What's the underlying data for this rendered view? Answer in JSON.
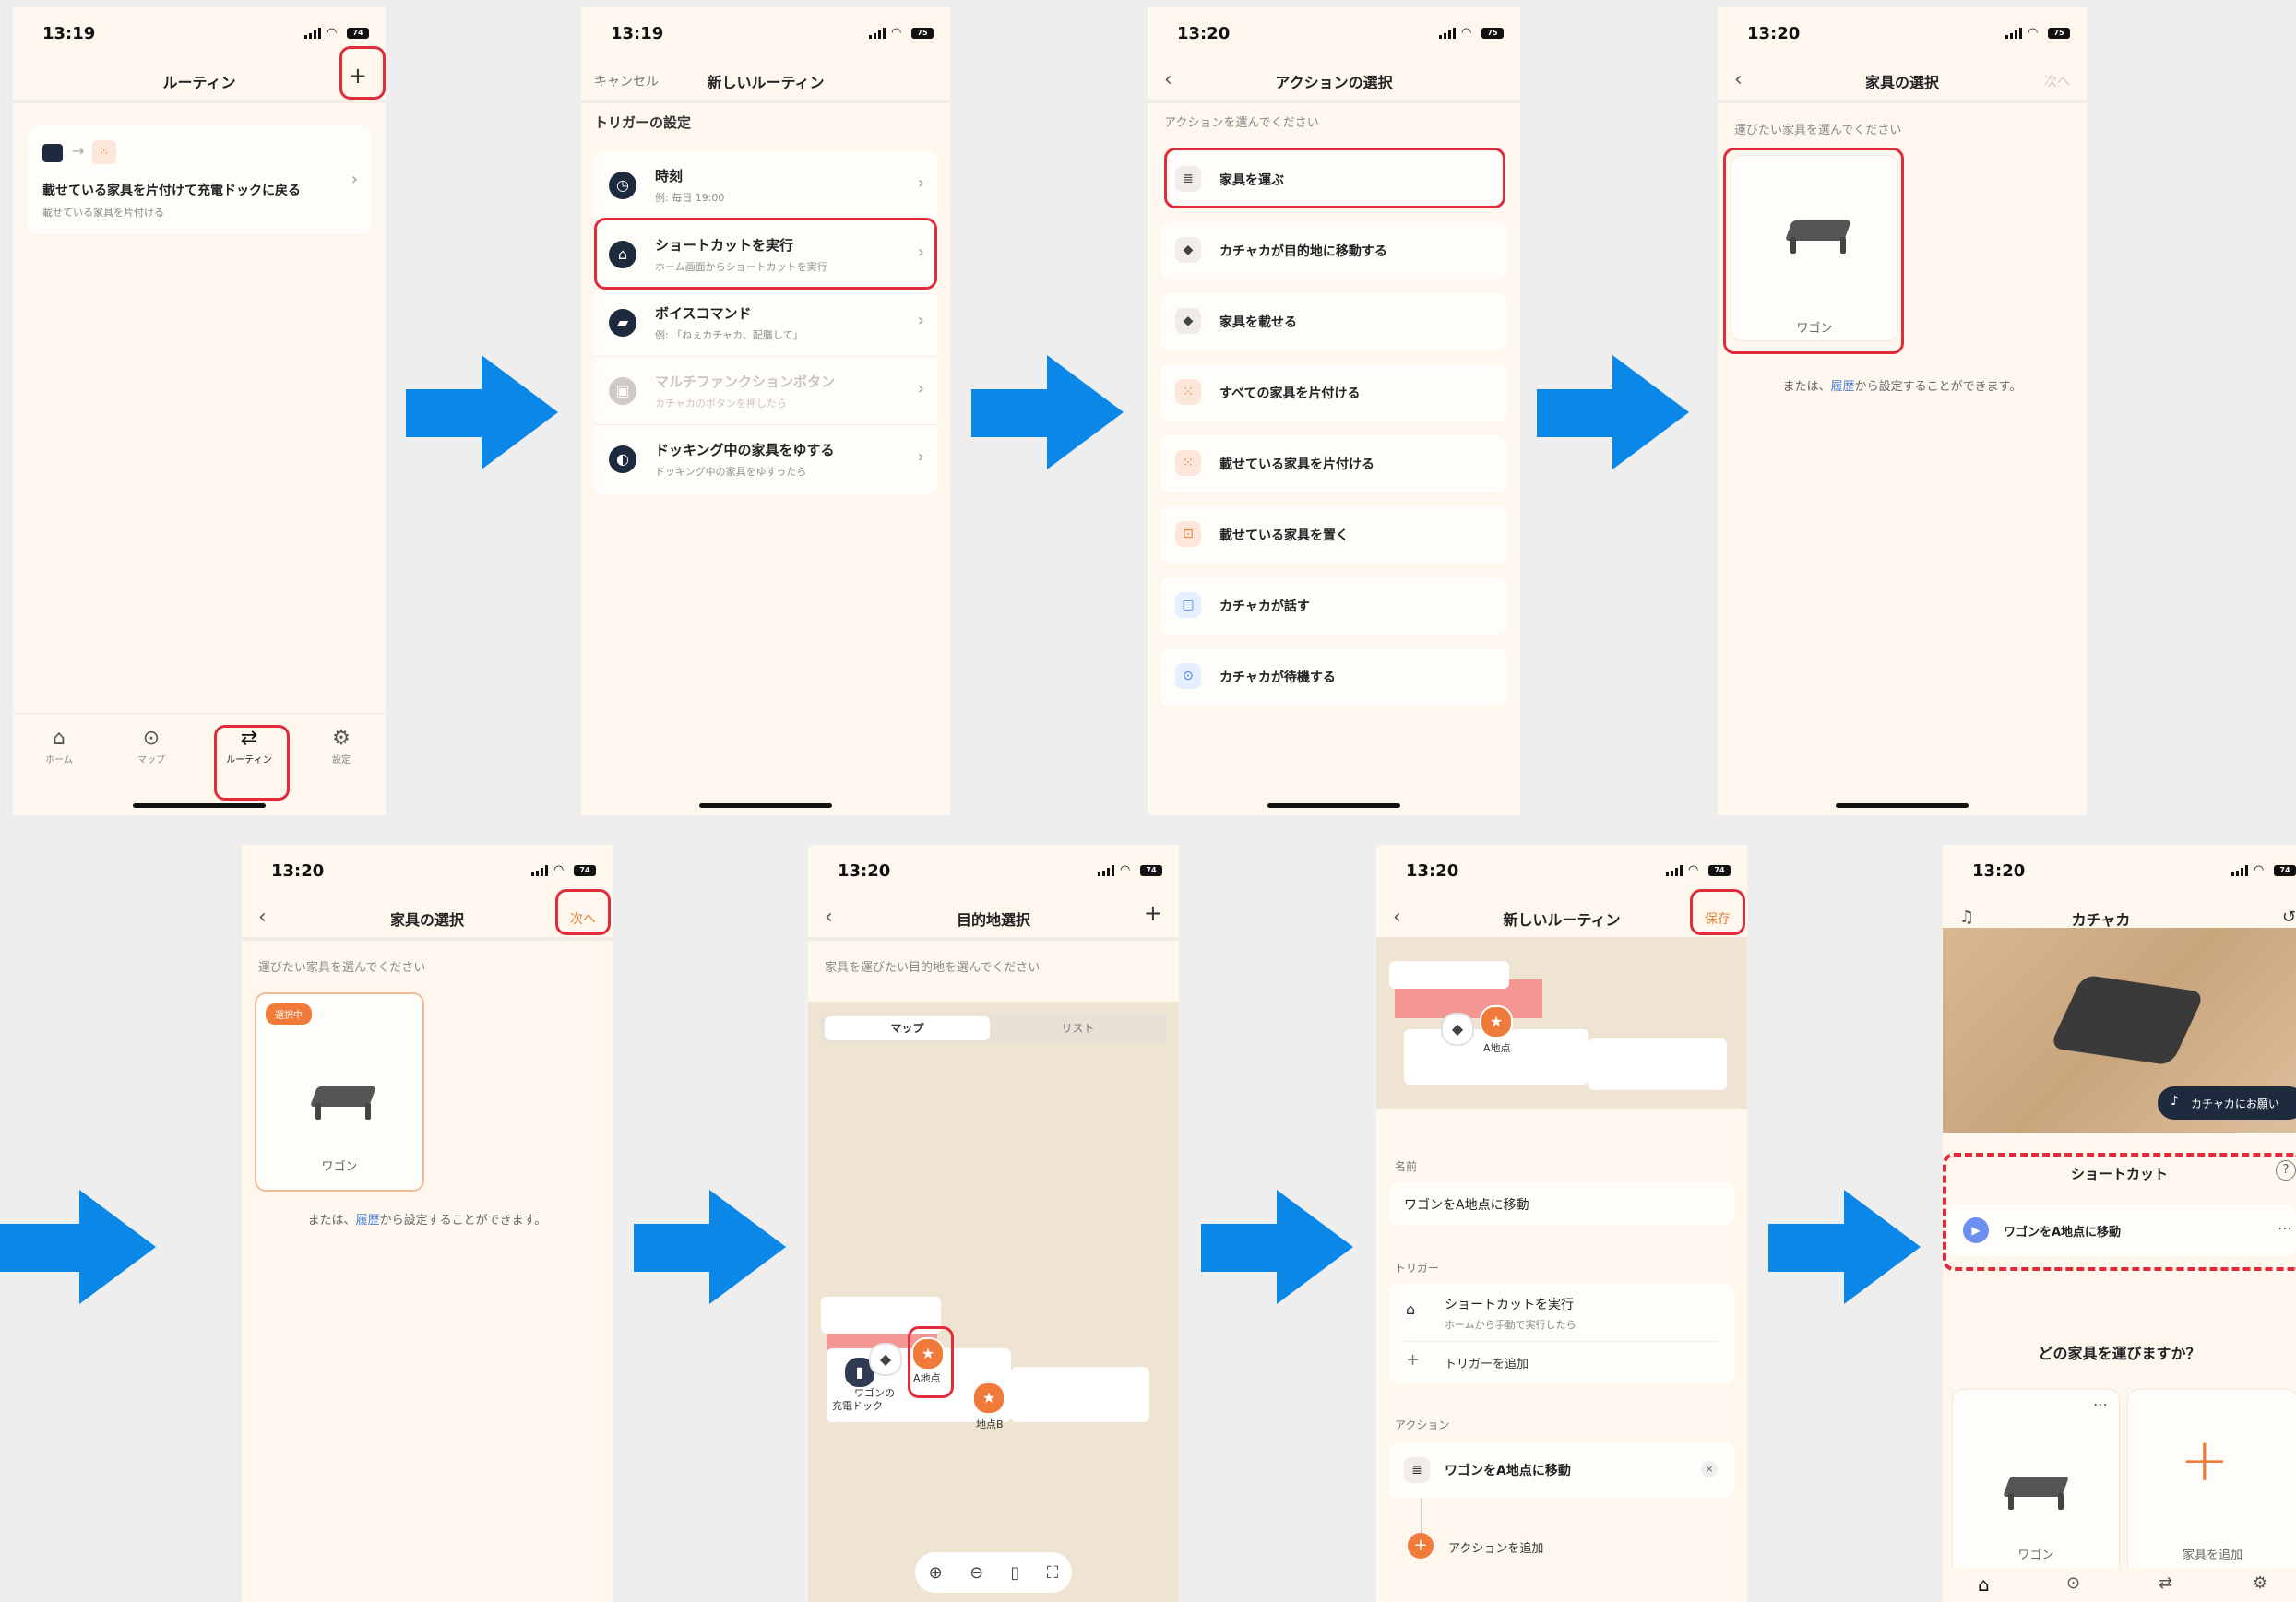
{
  "status": {
    "s1_time": "13:19",
    "s1_bat": "74",
    "s2_time": "13:19",
    "s2_bat": "75",
    "s3_time": "13:20",
    "s3_bat": "75",
    "s4_time": "13:20",
    "s4_bat": "75",
    "s5_time": "13:20",
    "s5_bat": "74",
    "s6_time": "13:20",
    "s6_bat": "74",
    "s7_time": "13:20",
    "s7_bat": "74",
    "s8_time": "13:20",
    "s8_bat": "74"
  },
  "screen1": {
    "title": "ルーティン",
    "add": "+",
    "routine_title": "載せている家具を片付けて充電ドックに戻る",
    "routine_sub": "載せている家具を片付ける",
    "tabs": [
      {
        "icon": "⌂",
        "label": "ホーム"
      },
      {
        "icon": "⊙",
        "label": "マップ"
      },
      {
        "icon": "⇄",
        "label": "ルーティン"
      },
      {
        "icon": "⚙",
        "label": "設定"
      }
    ]
  },
  "screen2": {
    "cancel": "キャンセル",
    "title": "新しいルーティン",
    "section": "トリガーの設定",
    "rows": [
      {
        "icon": "◷",
        "title": "時刻",
        "sub": "例: 毎日 19:00"
      },
      {
        "icon": "⌂",
        "title": "ショートカットを実行",
        "sub": "ホーム画面からショートカットを実行"
      },
      {
        "icon": "▰",
        "title": "ボイスコマンド",
        "sub": "例: 「ねぇカチャカ、配膳して」"
      },
      {
        "icon": "▣",
        "title": "マルチファンクションボタン",
        "sub": "カチャカのボタンを押したら"
      },
      {
        "icon": "◐",
        "title": "ドッキング中の家具をゆする",
        "sub": "ドッキング中の家具をゆすったら"
      }
    ]
  },
  "screen3": {
    "title": "アクションの選択",
    "hint": "アクションを選んでください",
    "actions": [
      {
        "icon": "≣",
        "label": "家具を運ぶ"
      },
      {
        "icon": "◆",
        "label": "カチャカが目的地に移動する"
      },
      {
        "icon": "◆",
        "label": "家具を載せる"
      },
      {
        "icon": "⁙",
        "label": "すべての家具を片付ける"
      },
      {
        "icon": "⁙",
        "label": "載せている家具を片付ける"
      },
      {
        "icon": "⊡",
        "label": "載せている家具を置く"
      },
      {
        "icon": "▢",
        "label": "カチャカが話す"
      },
      {
        "icon": "⊙",
        "label": "カチャカが待機する"
      }
    ]
  },
  "screen4": {
    "title": "家具の選択",
    "next": "次へ",
    "hint": "運びたい家具を選んでください",
    "furniture": "ワゴン",
    "or_pre": "または、",
    "or_link": "履歴",
    "or_post": "から設定することができます。"
  },
  "screen5": {
    "title": "家具の選択",
    "next": "次へ",
    "hint": "運びたい家具を選んでください",
    "badge": "選択中",
    "furniture": "ワゴン",
    "or_pre": "または、",
    "or_link": "履歴",
    "or_post": "から設定することができます。"
  },
  "screen6": {
    "title": "目的地選択",
    "add": "+",
    "hint": "家具を運びたい目的地を選んでください",
    "seg_map": "マップ",
    "seg_list": "リスト",
    "label_wagon": "ワゴンの",
    "label_dock": "充電ドック",
    "label_a": "A地点",
    "label_b": "地点B",
    "zoom": [
      "⊕",
      "⊖",
      "▯",
      "⛶"
    ]
  },
  "screen7": {
    "title": "新しいルーティン",
    "save": "保存",
    "map_label_a": "A地点",
    "name_label": "名前",
    "name_value": "ワゴンをA地点に移動",
    "trigger_label": "トリガー",
    "trigger_title": "ショートカットを実行",
    "trigger_sub": "ホームから手動で実行したら",
    "add_trigger": "トリガーを追加",
    "action_label": "アクション",
    "action_value": "ワゴンをA地点に移動",
    "add_action": "アクションを追加"
  },
  "screen8": {
    "title": "カチャカ",
    "voice_btn": "カチャカにお願い",
    "shortcut_title": "ショートカット",
    "shortcut_item": "ワゴンをA地点に移動",
    "question": "どの家具を運びますか？",
    "furniture": "ワゴン",
    "add_furniture": "家具を追加"
  }
}
